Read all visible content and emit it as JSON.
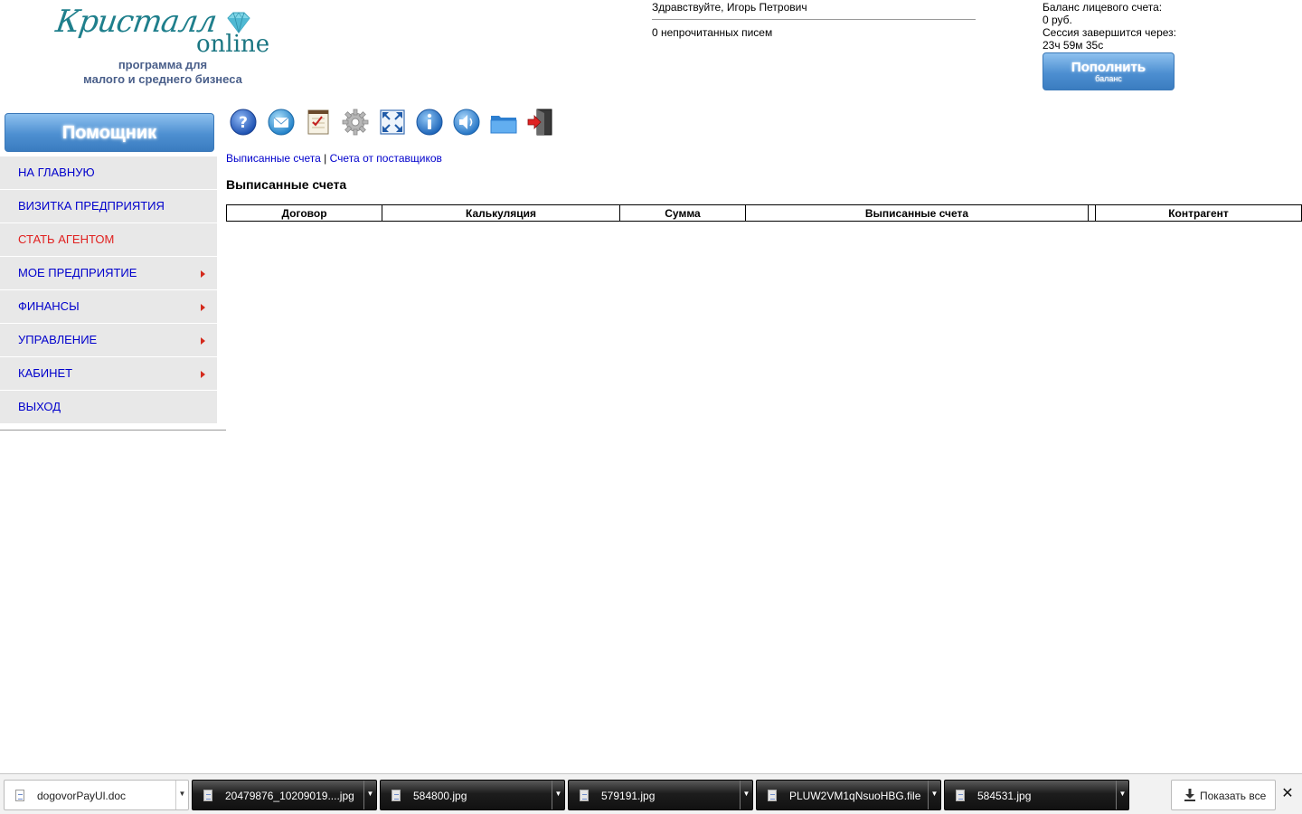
{
  "header": {
    "logo": {
      "script": "Кристалл",
      "online": "online",
      "subtitle_line1": "программа для",
      "subtitle_line2": "малого и среднего бизнеса"
    },
    "greeting": "Здравствуйте, Игорь Петрович",
    "unread": "0 непрочитанных писем",
    "balance": {
      "label": "Баланс лицевого счета:",
      "value": "0 руб.",
      "session_label": "Сессия завершится через:",
      "session_value": "23ч 59м 35с"
    },
    "topup": {
      "label": "Пополнить",
      "sublabel": "баланс"
    }
  },
  "sidebar": {
    "helper_label": "Помощник",
    "items": [
      {
        "label": "НА ГЛАВНУЮ",
        "color": "#0000cc",
        "has_arrow": false
      },
      {
        "label": "ВИЗИТКА ПРЕДПРИЯТИЯ",
        "color": "#0000cc",
        "has_arrow": false
      },
      {
        "label": "СТАТЬ АГЕНТОМ",
        "color": "#e0201f",
        "has_arrow": false
      },
      {
        "label": "МОЕ ПРЕДПРИЯТИЕ",
        "color": "#0000cc",
        "has_arrow": true
      },
      {
        "label": "ФИНАНСЫ",
        "color": "#0000cc",
        "has_arrow": true
      },
      {
        "label": "УПРАВЛЕНИЕ",
        "color": "#0000cc",
        "has_arrow": true
      },
      {
        "label": "КАБИНЕТ",
        "color": "#0000cc",
        "has_arrow": true
      },
      {
        "label": "ВЫХОД",
        "color": "#0000cc",
        "has_arrow": false
      }
    ]
  },
  "toolbar": {
    "icons": [
      "help-icon",
      "mail-icon",
      "notepad-icon",
      "settings-icon",
      "fullscreen-icon",
      "info-icon",
      "sound-icon",
      "folder-icon",
      "logout-icon"
    ]
  },
  "content": {
    "links": {
      "issued": "Выписанные счета",
      "separator": "|",
      "suppliers": "Счета от поставщиков"
    },
    "title": "Выписанные счета",
    "table": {
      "columns": [
        "Договор",
        "Калькуляция",
        "Сумма",
        "Выписанные счета",
        "",
        "Контрагент"
      ]
    }
  },
  "downloads": {
    "items": [
      "dogovorPayUl.doc",
      "20479876_10209019....jpg",
      "584800.jpg",
      "579191.jpg",
      "PLUW2VM1qNsuoHBG.file",
      "584531.jpg"
    ],
    "show_all": "Показать все",
    "close": "✕"
  },
  "colors": {
    "link": "#0000cc",
    "accent_red": "#e0201f",
    "button_blue": "#4d8fd1"
  }
}
